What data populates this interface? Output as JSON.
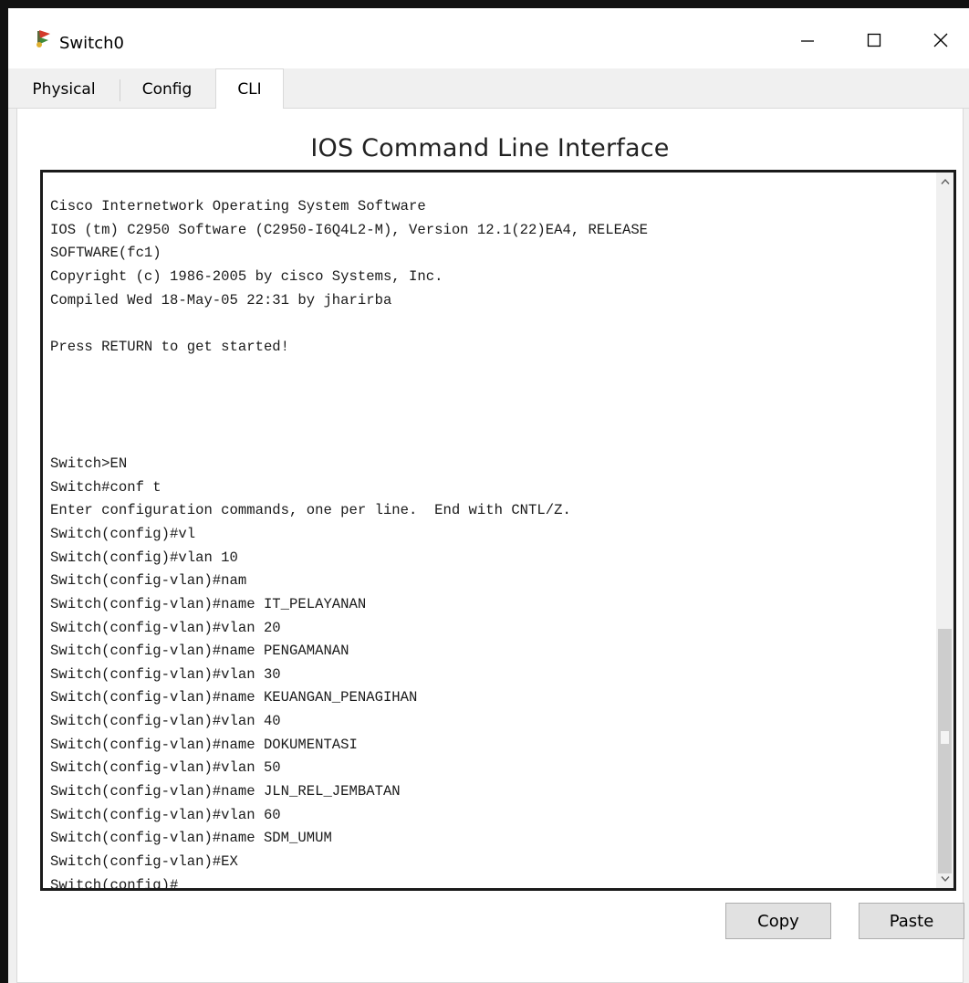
{
  "window": {
    "title": "Switch0"
  },
  "tabs": [
    {
      "label": "Physical"
    },
    {
      "label": "Config"
    },
    {
      "label": "CLI"
    }
  ],
  "active_tab": "CLI",
  "cli": {
    "heading": "IOS Command Line Interface",
    "lines": [
      "Cisco Internetwork Operating System Software",
      "IOS (tm) C2950 Software (C2950-I6Q4L2-M), Version 12.1(22)EA4, RELEASE",
      "SOFTWARE(fc1)",
      "Copyright (c) 1986-2005 by cisco Systems, Inc.",
      "Compiled Wed 18-May-05 22:31 by jharirba",
      "",
      "Press RETURN to get started!",
      "",
      "",
      "",
      "",
      "Switch>EN",
      "Switch#conf t",
      "Enter configuration commands, one per line.  End with CNTL/Z.",
      "Switch(config)#vl",
      "Switch(config)#vlan 10",
      "Switch(config-vlan)#nam",
      "Switch(config-vlan)#name IT_PELAYANAN",
      "Switch(config-vlan)#vlan 20",
      "Switch(config-vlan)#name PENGAMANAN",
      "Switch(config-vlan)#vlan 30",
      "Switch(config-vlan)#name KEUANGAN_PENAGIHAN",
      "Switch(config-vlan)#vlan 40",
      "Switch(config-vlan)#name DOKUMENTASI",
      "Switch(config-vlan)#vlan 50",
      "Switch(config-vlan)#name JLN_REL_JEMBATAN",
      "Switch(config-vlan)#vlan 60",
      "Switch(config-vlan)#name SDM_UMUM",
      "Switch(config-vlan)#EX",
      "Switch(config)#"
    ]
  },
  "buttons": {
    "copy": "Copy",
    "paste": "Paste"
  },
  "icons": {
    "app": "cisco-switch-icon",
    "minimize": "minimize-icon",
    "maximize": "maximize-icon",
    "close": "close-icon",
    "scroll_up": "chevron-up-icon",
    "scroll_down": "chevron-down-icon"
  }
}
